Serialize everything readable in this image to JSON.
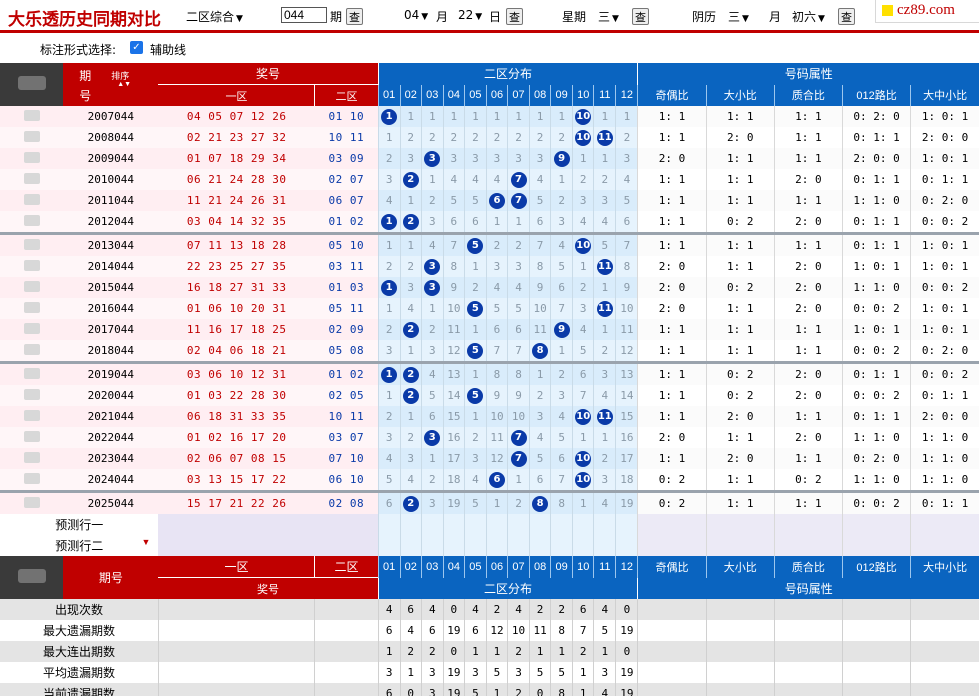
{
  "top": {
    "title": "大乐透历史同期对比",
    "zone_select": "二区综合",
    "issue_value": "044",
    "issue_unit": "期",
    "query_btn": "查",
    "month_value": "04",
    "month_unit": "月",
    "day_value": "22",
    "day_unit": "日",
    "week_label": "星期",
    "week_value": "三",
    "lunar_label": "阴历",
    "lunar_month": "三",
    "lunar_month_unit": "月",
    "lunar_day": "初六",
    "logo": "cz89.com"
  },
  "options": {
    "label": "标注形式选择:",
    "checkbox_label": "辅助线"
  },
  "header": {
    "period": "期号",
    "period_a": "期",
    "period_b": "号",
    "sort": "排序",
    "prize": "奖号",
    "zone1": "一区",
    "zone2": "二区",
    "dist": "二区分布",
    "attr": "号码属性",
    "nums": [
      "01",
      "02",
      "03",
      "04",
      "05",
      "06",
      "07",
      "08",
      "09",
      "10",
      "11",
      "12"
    ],
    "attrs": [
      "奇偶比",
      "大小比",
      "质合比",
      "012路比",
      "大中小比"
    ]
  },
  "rows": [
    {
      "period": "2007044",
      "z1": "04 05 07 12 26",
      "z2": "01 10",
      "cells": [
        "1",
        "1",
        "1",
        "1",
        "1",
        "1",
        "1",
        "1",
        "1",
        "10",
        "1",
        "1"
      ],
      "balls": [
        1,
        10
      ],
      "attrs": [
        "1: 1",
        "1: 1",
        "1: 1",
        "0: 2: 0",
        "1: 0: 1"
      ]
    },
    {
      "period": "2008044",
      "z1": "02 21 23 27 32",
      "z2": "10 11",
      "cells": [
        "1",
        "2",
        "2",
        "2",
        "2",
        "2",
        "2",
        "2",
        "2",
        "10",
        "11",
        "2"
      ],
      "balls": [
        10,
        11
      ],
      "attrs": [
        "1: 1",
        "2: 0",
        "1: 1",
        "0: 1: 1",
        "2: 0: 0"
      ]
    },
    {
      "period": "2009044",
      "z1": "01 07 18 29 34",
      "z2": "03 09",
      "cells": [
        "2",
        "3",
        "3",
        "3",
        "3",
        "3",
        "3",
        "3",
        "9",
        "1",
        "1",
        "3"
      ],
      "balls": [
        3,
        9
      ],
      "attrs": [
        "2: 0",
        "1: 1",
        "1: 1",
        "2: 0: 0",
        "1: 0: 1"
      ]
    },
    {
      "period": "2010044",
      "z1": "06 21 24 28 30",
      "z2": "02 07",
      "cells": [
        "3",
        "2",
        "1",
        "4",
        "4",
        "4",
        "7",
        "4",
        "1",
        "2",
        "2",
        "4"
      ],
      "balls": [
        2,
        7
      ],
      "attrs": [
        "1: 1",
        "1: 1",
        "2: 0",
        "0: 1: 1",
        "0: 1: 1"
      ]
    },
    {
      "period": "2011044",
      "z1": "11 21 24 26 31",
      "z2": "06 07",
      "cells": [
        "4",
        "1",
        "2",
        "5",
        "5",
        "6",
        "7",
        "5",
        "2",
        "3",
        "3",
        "5"
      ],
      "balls": [
        6,
        7
      ],
      "attrs": [
        "1: 1",
        "1: 1",
        "1: 1",
        "1: 1: 0",
        "0: 2: 0"
      ]
    },
    {
      "period": "2012044",
      "z1": "03 04 14 32 35",
      "z2": "01 02",
      "cells": [
        "1",
        "2",
        "3",
        "6",
        "6",
        "1",
        "1",
        "6",
        "3",
        "4",
        "4",
        "6"
      ],
      "balls": [
        1,
        2
      ],
      "attrs": [
        "1: 1",
        "0: 2",
        "2: 0",
        "0: 1: 1",
        "0: 0: 2"
      ]
    },
    {
      "period": "2013044",
      "z1": "07 11 13 18 28",
      "z2": "05 10",
      "cells": [
        "1",
        "1",
        "4",
        "7",
        "5",
        "2",
        "2",
        "7",
        "4",
        "10",
        "5",
        "7"
      ],
      "balls": [
        5,
        10
      ],
      "attrs": [
        "1: 1",
        "1: 1",
        "1: 1",
        "0: 1: 1",
        "1: 0: 1"
      ],
      "sep": true
    },
    {
      "period": "2014044",
      "z1": "22 23 25 27 35",
      "z2": "03 11",
      "cells": [
        "2",
        "2",
        "3",
        "8",
        "1",
        "3",
        "3",
        "8",
        "5",
        "1",
        "11",
        "8"
      ],
      "balls": [
        3,
        11
      ],
      "attrs": [
        "2: 0",
        "1: 1",
        "2: 0",
        "1: 0: 1",
        "1: 0: 1"
      ]
    },
    {
      "period": "2015044",
      "z1": "16 18 27 31 33",
      "z2": "01 03",
      "cells": [
        "1",
        "3",
        "3",
        "9",
        "2",
        "4",
        "4",
        "9",
        "6",
        "2",
        "1",
        "9"
      ],
      "balls": [
        1,
        3
      ],
      "attrs": [
        "2: 0",
        "0: 2",
        "2: 0",
        "1: 1: 0",
        "0: 0: 2"
      ]
    },
    {
      "period": "2016044",
      "z1": "01 06 10 20 31",
      "z2": "05 11",
      "cells": [
        "1",
        "4",
        "1",
        "10",
        "5",
        "5",
        "5",
        "10",
        "7",
        "3",
        "11",
        "10"
      ],
      "balls": [
        5,
        11
      ],
      "attrs": [
        "2: 0",
        "1: 1",
        "2: 0",
        "0: 0: 2",
        "1: 0: 1"
      ]
    },
    {
      "period": "2017044",
      "z1": "11 16 17 18 25",
      "z2": "02 09",
      "cells": [
        "2",
        "2",
        "2",
        "11",
        "1",
        "6",
        "6",
        "11",
        "9",
        "4",
        "1",
        "11"
      ],
      "balls": [
        2,
        9
      ],
      "attrs": [
        "1: 1",
        "1: 1",
        "1: 1",
        "1: 0: 1",
        "1: 0: 1"
      ]
    },
    {
      "period": "2018044",
      "z1": "02 04 06 18 21",
      "z2": "05 08",
      "cells": [
        "3",
        "1",
        "3",
        "12",
        "5",
        "7",
        "7",
        "8",
        "1",
        "5",
        "2",
        "12"
      ],
      "balls": [
        5,
        8
      ],
      "attrs": [
        "1: 1",
        "1: 1",
        "1: 1",
        "0: 0: 2",
        "0: 2: 0"
      ]
    },
    {
      "period": "2019044",
      "z1": "03 06 10 12 31",
      "z2": "01 02",
      "cells": [
        "1",
        "2",
        "4",
        "13",
        "1",
        "8",
        "8",
        "1",
        "2",
        "6",
        "3",
        "13"
      ],
      "balls": [
        1,
        2
      ],
      "attrs": [
        "1: 1",
        "0: 2",
        "2: 0",
        "0: 1: 1",
        "0: 0: 2"
      ],
      "sep": true
    },
    {
      "period": "2020044",
      "z1": "01 03 22 28 30",
      "z2": "02 05",
      "cells": [
        "1",
        "2",
        "5",
        "14",
        "5",
        "9",
        "9",
        "2",
        "3",
        "7",
        "4",
        "14"
      ],
      "balls": [
        2,
        5
      ],
      "attrs": [
        "1: 1",
        "0: 2",
        "2: 0",
        "0: 0: 2",
        "0: 1: 1"
      ]
    },
    {
      "period": "2021044",
      "z1": "06 18 31 33 35",
      "z2": "10 11",
      "cells": [
        "2",
        "1",
        "6",
        "15",
        "1",
        "10",
        "10",
        "3",
        "4",
        "10",
        "11",
        "15"
      ],
      "balls": [
        10,
        11
      ],
      "attrs": [
        "1: 1",
        "2: 0",
        "1: 1",
        "0: 1: 1",
        "2: 0: 0"
      ]
    },
    {
      "period": "2022044",
      "z1": "01 02 16 17 20",
      "z2": "03 07",
      "cells": [
        "3",
        "2",
        "3",
        "16",
        "2",
        "11",
        "7",
        "4",
        "5",
        "1",
        "1",
        "16"
      ],
      "balls": [
        3,
        7
      ],
      "attrs": [
        "2: 0",
        "1: 1",
        "2: 0",
        "1: 1: 0",
        "1: 1: 0"
      ]
    },
    {
      "period": "2023044",
      "z1": "02 06 07 08 15",
      "z2": "07 10",
      "cells": [
        "4",
        "3",
        "1",
        "17",
        "3",
        "12",
        "7",
        "5",
        "6",
        "10",
        "2",
        "17"
      ],
      "balls": [
        7,
        10
      ],
      "attrs": [
        "1: 1",
        "2: 0",
        "1: 1",
        "0: 2: 0",
        "1: 1: 0"
      ]
    },
    {
      "period": "2024044",
      "z1": "03 13 15 17 22",
      "z2": "06 10",
      "cells": [
        "5",
        "4",
        "2",
        "18",
        "4",
        "6",
        "1",
        "6",
        "7",
        "10",
        "3",
        "18"
      ],
      "balls": [
        6,
        10
      ],
      "attrs": [
        "0: 2",
        "1: 1",
        "0: 2",
        "1: 1: 0",
        "1: 1: 0"
      ]
    },
    {
      "period": "2025044",
      "z1": "15 17 21 22 26",
      "z2": "02 08",
      "cells": [
        "6",
        "2",
        "3",
        "19",
        "5",
        "1",
        "2",
        "8",
        "8",
        "1",
        "4",
        "19"
      ],
      "balls": [
        2,
        8
      ],
      "attrs": [
        "0: 2",
        "1: 1",
        "1: 1",
        "0: 0: 2",
        "0: 1: 1"
      ],
      "sep": true
    }
  ],
  "predict": [
    "预测行一",
    "预测行二"
  ],
  "footer_header": {
    "period": "期号",
    "zone1": "一区",
    "zone2": "二区",
    "prize": "奖号",
    "dist": "二区分布",
    "attr": "号码属性"
  },
  "stats": [
    {
      "label": "出现次数",
      "values": [
        "4",
        "6",
        "4",
        "0",
        "4",
        "2",
        "4",
        "2",
        "2",
        "6",
        "4",
        "0"
      ]
    },
    {
      "label": "最大遗漏期数",
      "values": [
        "6",
        "4",
        "6",
        "19",
        "6",
        "12",
        "10",
        "11",
        "8",
        "7",
        "5",
        "19"
      ]
    },
    {
      "label": "最大连出期数",
      "values": [
        "1",
        "2",
        "2",
        "0",
        "1",
        "1",
        "2",
        "1",
        "1",
        "2",
        "1",
        "0"
      ]
    },
    {
      "label": "平均遗漏期数",
      "values": [
        "3",
        "1",
        "3",
        "19",
        "3",
        "5",
        "3",
        "5",
        "5",
        "1",
        "3",
        "19"
      ]
    },
    {
      "label": "当前遗漏期数",
      "values": [
        "6",
        "0",
        "3",
        "19",
        "5",
        "1",
        "2",
        "0",
        "8",
        "1",
        "4",
        "19"
      ]
    }
  ]
}
